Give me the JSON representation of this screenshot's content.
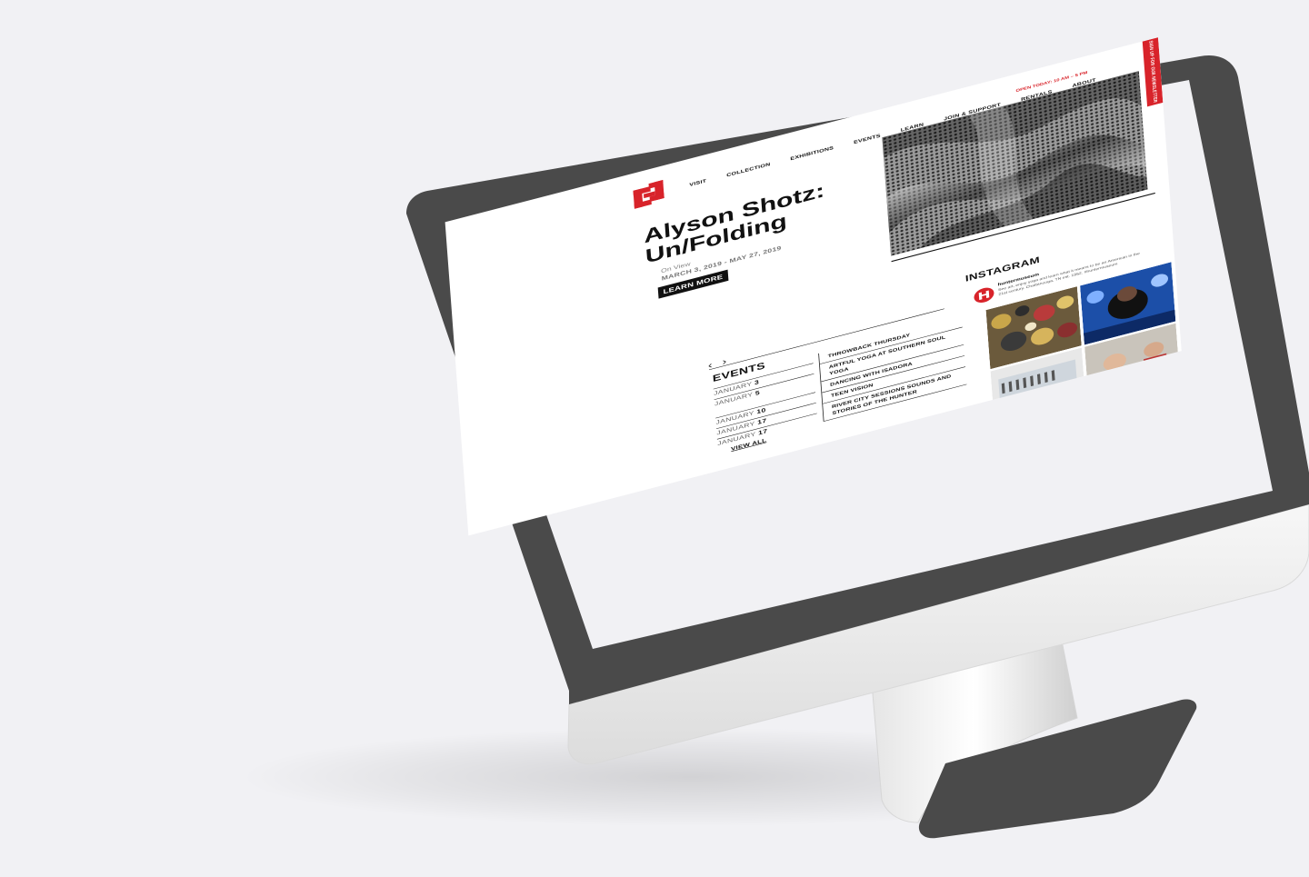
{
  "site": {
    "nav": {
      "visit": "VISIT",
      "collection": "COLLECTION",
      "exhibitions": "EXHIBITIONS",
      "events": "EVENTS",
      "learn": "LEARN",
      "join": "JOIN & SUPPORT",
      "rentals": "RENTALS",
      "about": "ABOUT",
      "open_today": "OPEN TODAY: 10 AM – 5 PM"
    },
    "newsletter": "SIGN UP FOR OUR NEWSLETTER",
    "hero": {
      "title": "Alyson Shotz:\nUn/Folding",
      "status": "On View",
      "dates": "MARCH 3, 2019 - MAY 27, 2019",
      "cta": "LEARN MORE"
    },
    "carousel": {
      "prev": "‹",
      "next": "›"
    },
    "events": {
      "heading": "EVENTS",
      "items": [
        {
          "month": "JANUARY",
          "day": "3",
          "title": "THROWBACK THURSDAY"
        },
        {
          "month": "JANUARY",
          "day": "5",
          "title": "ARTFUL YOGA AT SOUTHERN SOUL YOGA"
        },
        {
          "month": "JANUARY",
          "day": "10",
          "title": "DANCING WITH ISADORA"
        },
        {
          "month": "JANUARY",
          "day": "17",
          "title": "TEEN VISION"
        },
        {
          "month": "JANUARY",
          "day": "17",
          "title": "RIVER CITY SESSIONS SOUNDS AND STORIES OF THE HUNTER"
        }
      ],
      "view_all": "VIEW ALL"
    },
    "instagram": {
      "heading": "INSTAGRAM",
      "handle": "huntermuseum",
      "caption": "See art, enjoy yoga and learn what it means to be an American in the 21st century. Chattanooga, TN est. 1952. #huntermuseum"
    },
    "colors": {
      "brand_red": "#d8232a",
      "text": "#111111",
      "bezel": "#4a4a4a"
    }
  }
}
